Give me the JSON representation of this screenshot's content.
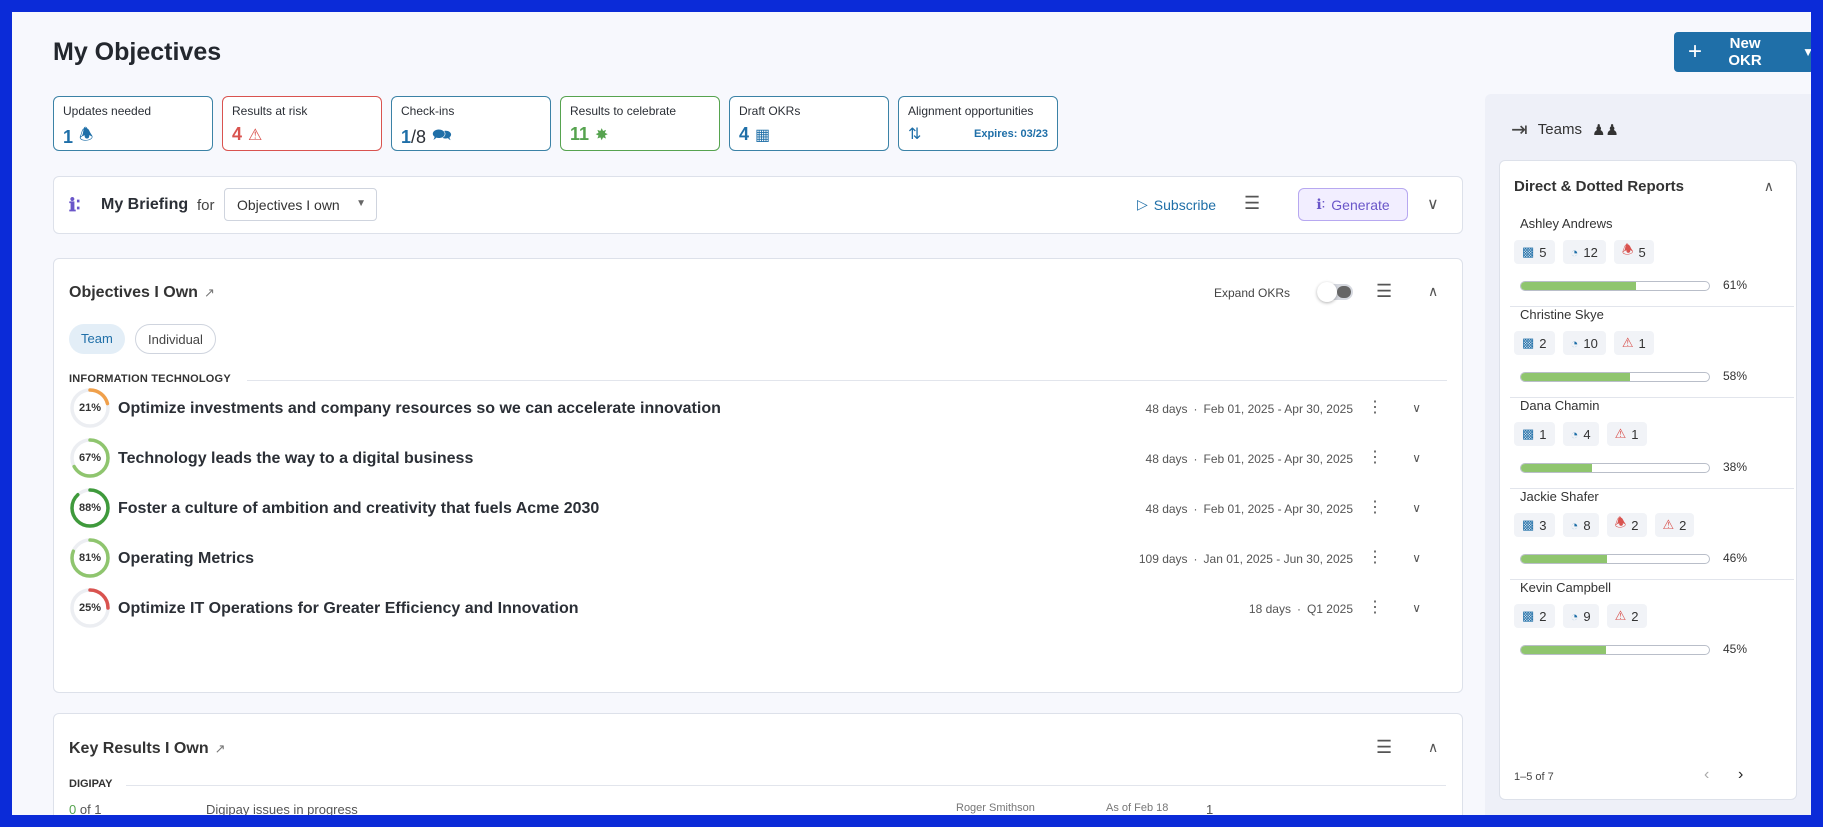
{
  "page": {
    "title": "My Objectives"
  },
  "actions": {
    "new_okr": "New OKR"
  },
  "stats": [
    {
      "label": "Updates needed",
      "value": "1",
      "icon": "bell-icon"
    },
    {
      "label": "Results at risk",
      "value": "4",
      "icon": "warning-icon",
      "color": "#d9534f"
    },
    {
      "label": "Check-ins",
      "value": "1",
      "total": "/8",
      "icon": "chat-icon"
    },
    {
      "label": "Results to celebrate",
      "value": "11",
      "icon": "party-icon",
      "color": "#56a34f"
    },
    {
      "label": "Draft OKRs",
      "value": "4",
      "icon": "chart-icon"
    },
    {
      "label": "Alignment opportunities",
      "value": "",
      "icon": "align-icon",
      "note": "Expires: 03/23"
    }
  ],
  "briefing": {
    "title": "My Briefing",
    "for": "for",
    "selected": "Objectives I own",
    "subscribe": "Subscribe",
    "generate": "Generate"
  },
  "objectives": {
    "title": "Objectives I Own",
    "expand_label": "Expand OKRs",
    "tabs": [
      "Team",
      "Individual"
    ],
    "group": "INFORMATION TECHNOLOGY",
    "rows": [
      {
        "progress": 21,
        "progress_label": "21%",
        "name": "Optimize investments and company resources so we can accelerate innovation",
        "days": "48 days",
        "range": "Feb 01, 2025 - Apr 30, 2025",
        "color": "#f0a04b"
      },
      {
        "progress": 67,
        "progress_label": "67%",
        "name": "Technology leads the way to a digital business",
        "days": "48 days",
        "range": "Feb 01, 2025 - Apr 30, 2025",
        "color": "#8fc56e"
      },
      {
        "progress": 88,
        "progress_label": "88%",
        "name": "Foster a culture of ambition and creativity that fuels Acme 2030",
        "days": "48 days",
        "range": "Feb 01, 2025 - Apr 30, 2025",
        "color": "#3f9a3c"
      },
      {
        "progress": 81,
        "progress_label": "81%",
        "name": "Operating Metrics",
        "days": "109 days",
        "range": "Jan 01, 2025 - Jun 30, 2025",
        "color": "#8fc56e"
      },
      {
        "progress": 25,
        "progress_label": "25%",
        "name": "Optimize IT Operations for Greater Efficiency and Innovation",
        "days": "18 days",
        "range": "Q1 2025",
        "color": "#d9534f"
      }
    ]
  },
  "key_results": {
    "title": "Key Results I Own",
    "group": "DIGIPAY",
    "row": {
      "progress_done": "0",
      "progress_rest": " of 1",
      "name": "Digipay issues in progress",
      "owner": "Roger Smithson",
      "as_of": "As of Feb 18",
      "count": "1"
    }
  },
  "teams": {
    "title": "Teams",
    "reports_title": "Direct & Dotted Reports",
    "pager": "1–5 of 7",
    "people": [
      {
        "name": "Ashley Andrews",
        "objectives": "5",
        "key_results": "12",
        "alerts": "5",
        "risks": "",
        "progress": 61,
        "progress_label": "61%"
      },
      {
        "name": "Christine Skye",
        "objectives": "2",
        "key_results": "10",
        "alerts": "",
        "risks": "1",
        "progress": 58,
        "progress_label": "58%"
      },
      {
        "name": "Dana Chamin",
        "objectives": "1",
        "key_results": "4",
        "alerts": "",
        "risks": "1",
        "progress": 38,
        "progress_label": "38%"
      },
      {
        "name": "Jackie Shafer",
        "objectives": "3",
        "key_results": "8",
        "alerts": "2",
        "risks": "2",
        "progress": 46,
        "progress_label": "46%"
      },
      {
        "name": "Kevin Campbell",
        "objectives": "2",
        "key_results": "9",
        "alerts": "",
        "risks": "2",
        "progress": 45,
        "progress_label": "45%"
      }
    ]
  }
}
